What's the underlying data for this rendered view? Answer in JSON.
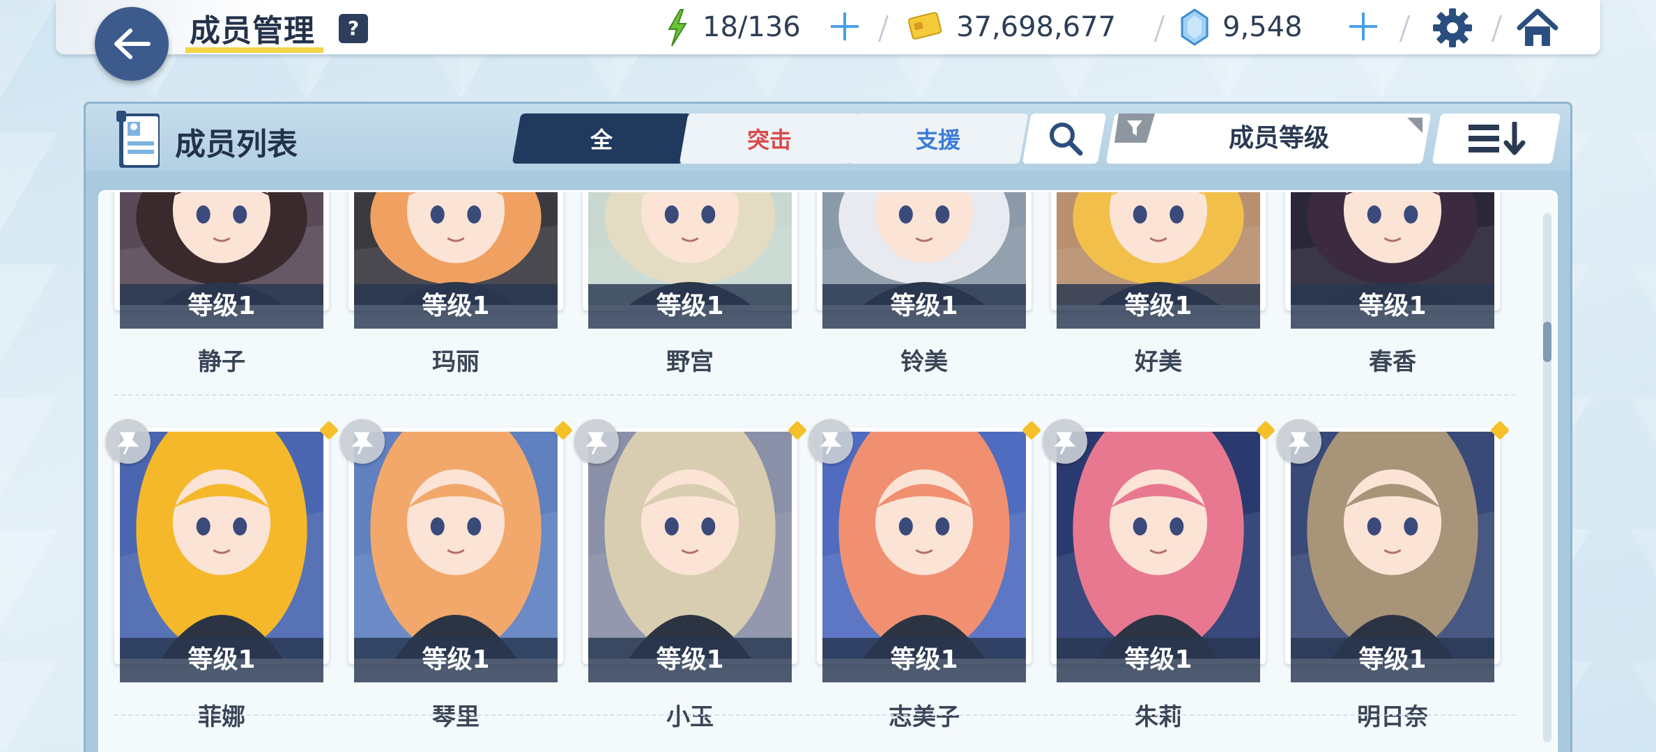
{
  "header": {
    "title": "成员管理",
    "help": "?",
    "ap": "18/136",
    "credits": "37,698,677",
    "gems": "9,548"
  },
  "panel": {
    "title": "成员列表",
    "tabs": [
      {
        "label": "全",
        "color": "#ffffff"
      },
      {
        "label": "突击",
        "color": "#d84a4a"
      },
      {
        "label": "支援",
        "color": "#3d7bd6"
      }
    ],
    "sort_label": "成员等级"
  },
  "members_row1": [
    {
      "name": "静子",
      "level": "等级1",
      "hair": "#3a2a2e",
      "bg": "#5a4a58"
    },
    {
      "name": "玛丽",
      "level": "等级1",
      "hair": "#f0a060",
      "bg": "#3a3a40"
    },
    {
      "name": "野宫",
      "level": "等级1",
      "hair": "#e3dcc3",
      "bg": "#c8d8d0"
    },
    {
      "name": "铃美",
      "level": "等级1",
      "hair": "#e8eaf0",
      "bg": "#8a9aa8"
    },
    {
      "name": "好美",
      "level": "等级1",
      "hair": "#f2c04a",
      "bg": "#b89070"
    },
    {
      "name": "春香",
      "level": "等级1",
      "hair": "#3c2a40",
      "bg": "#2a2838"
    }
  ],
  "members_row2": [
    {
      "name": "菲娜",
      "level": "等级1",
      "hair": "#f5b82a",
      "bg": "#4a66b0"
    },
    {
      "name": "琴里",
      "level": "等级1",
      "hair": "#f2a86a",
      "bg": "#6080c0"
    },
    {
      "name": "小玉",
      "level": "等级1",
      "hair": "#d8cdb0",
      "bg": "#8a90a8"
    },
    {
      "name": "志美子",
      "level": "等级1",
      "hair": "#f09070",
      "bg": "#506cc0"
    },
    {
      "name": "朱莉",
      "level": "等级1",
      "hair": "#e87890",
      "bg": "#2a3a70"
    },
    {
      "name": "明日奈",
      "level": "等级1",
      "hair": "#a89478",
      "bg": "#3a4a78"
    }
  ]
}
